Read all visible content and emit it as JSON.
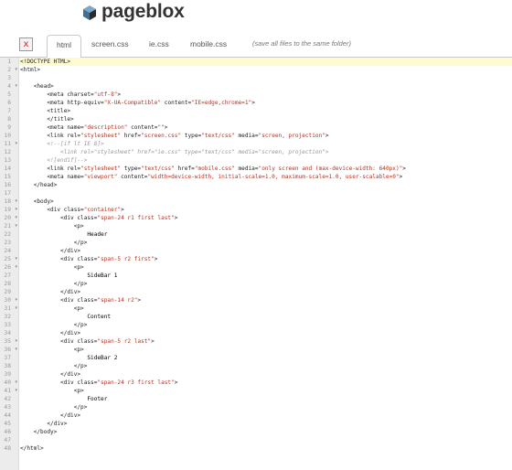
{
  "brand": {
    "name": "pageblox",
    "icon": "cube-icon"
  },
  "tabs": [
    {
      "label": "html",
      "active": true
    },
    {
      "label": "screen.css",
      "active": false
    },
    {
      "label": "ie.css",
      "active": false
    },
    {
      "label": "mobile.css",
      "active": false
    }
  ],
  "save_hint": "(save all files to the same folder)",
  "close_label": "x",
  "editor": {
    "current_line": 1,
    "lines": [
      {
        "n": "1",
        "fold": "",
        "segs": [
          [
            "tag",
            "<!DOCTYPE HTML>"
          ]
        ]
      },
      {
        "n": "2",
        "fold": "▾",
        "segs": [
          [
            "tag",
            "<html>"
          ]
        ]
      },
      {
        "n": "3",
        "fold": "",
        "segs": []
      },
      {
        "n": "4",
        "fold": "▾",
        "segs": [
          [
            "text",
            "    "
          ],
          [
            "tag",
            "<head>"
          ]
        ]
      },
      {
        "n": "5",
        "fold": "",
        "segs": [
          [
            "text",
            "        "
          ],
          [
            "tag",
            "<meta "
          ],
          [
            "attr",
            "charset="
          ],
          [
            "str",
            "\"utf-8\""
          ],
          [
            "tag",
            ">"
          ]
        ]
      },
      {
        "n": "6",
        "fold": "",
        "segs": [
          [
            "text",
            "        "
          ],
          [
            "tag",
            "<meta "
          ],
          [
            "attr",
            "http-equiv="
          ],
          [
            "str",
            "\"X-UA-Compatible\""
          ],
          [
            "attr",
            " content="
          ],
          [
            "str",
            "\"IE=edge,chrome=1\""
          ],
          [
            "tag",
            ">"
          ]
        ]
      },
      {
        "n": "7",
        "fold": "",
        "segs": [
          [
            "text",
            "        "
          ],
          [
            "tag",
            "<title>"
          ]
        ]
      },
      {
        "n": "8",
        "fold": "",
        "segs": [
          [
            "text",
            "        "
          ],
          [
            "tag",
            "</title>"
          ]
        ]
      },
      {
        "n": "9",
        "fold": "",
        "segs": [
          [
            "text",
            "        "
          ],
          [
            "tag",
            "<meta "
          ],
          [
            "attr",
            "name="
          ],
          [
            "str",
            "\"description\""
          ],
          [
            "attr",
            " content="
          ],
          [
            "str",
            "\"\""
          ],
          [
            "tag",
            ">"
          ]
        ]
      },
      {
        "n": "10",
        "fold": "",
        "segs": [
          [
            "text",
            "        "
          ],
          [
            "tag",
            "<link "
          ],
          [
            "attr",
            "rel="
          ],
          [
            "str",
            "\"stylesheet\""
          ],
          [
            "attr",
            " href="
          ],
          [
            "str",
            "\"screen.css\""
          ],
          [
            "attr",
            " type="
          ],
          [
            "str",
            "\"text/css\""
          ],
          [
            "attr",
            " media="
          ],
          [
            "str",
            "\"screen, projection\""
          ],
          [
            "tag",
            ">"
          ]
        ]
      },
      {
        "n": "11",
        "fold": "▾",
        "segs": [
          [
            "comment",
            "        <!--[if lt IE 8]>"
          ]
        ]
      },
      {
        "n": "12",
        "fold": "",
        "segs": [
          [
            "comment",
            "            <link rel=\"stylesheet\" href=\"ie.css\" type=\"text/css\" media=\"screen, projection\">"
          ]
        ]
      },
      {
        "n": "13",
        "fold": "",
        "segs": [
          [
            "comment",
            "        <![endif]-->"
          ]
        ]
      },
      {
        "n": "14",
        "fold": "",
        "segs": [
          [
            "text",
            "        "
          ],
          [
            "tag",
            "<link "
          ],
          [
            "attr",
            "rel="
          ],
          [
            "str",
            "\"stylesheet\""
          ],
          [
            "attr",
            " type="
          ],
          [
            "str",
            "\"text/css\""
          ],
          [
            "attr",
            " href="
          ],
          [
            "str",
            "\"mobile.css\""
          ],
          [
            "attr",
            " media="
          ],
          [
            "str",
            "\"only screen and (max-device-width: 640px)\""
          ],
          [
            "tag",
            ">"
          ]
        ]
      },
      {
        "n": "15",
        "fold": "",
        "segs": [
          [
            "text",
            "        "
          ],
          [
            "tag",
            "<meta "
          ],
          [
            "attr",
            "name="
          ],
          [
            "str",
            "\"viewport\""
          ],
          [
            "attr",
            " content="
          ],
          [
            "str",
            "\"width=device-width, initial-scale=1.0, maximum-scale=1.0, user-scalable=0\""
          ],
          [
            "tag",
            ">"
          ]
        ]
      },
      {
        "n": "16",
        "fold": "",
        "segs": [
          [
            "text",
            "    "
          ],
          [
            "tag",
            "</head>"
          ]
        ]
      },
      {
        "n": "17",
        "fold": "",
        "segs": []
      },
      {
        "n": "18",
        "fold": "▾",
        "segs": [
          [
            "text",
            "    "
          ],
          [
            "tag",
            "<body>"
          ]
        ]
      },
      {
        "n": "19",
        "fold": "▾",
        "segs": [
          [
            "text",
            "        "
          ],
          [
            "tag",
            "<div "
          ],
          [
            "attr",
            "class="
          ],
          [
            "str",
            "\"container\""
          ],
          [
            "tag",
            ">"
          ]
        ]
      },
      {
        "n": "20",
        "fold": "▾",
        "segs": [
          [
            "text",
            "            "
          ],
          [
            "tag",
            "<div "
          ],
          [
            "attr",
            "class="
          ],
          [
            "str",
            "\"span-24 r1 first last\""
          ],
          [
            "tag",
            ">"
          ]
        ]
      },
      {
        "n": "21",
        "fold": "▾",
        "segs": [
          [
            "text",
            "                "
          ],
          [
            "tag",
            "<p>"
          ]
        ]
      },
      {
        "n": "22",
        "fold": "",
        "segs": [
          [
            "text",
            "                    Header"
          ]
        ]
      },
      {
        "n": "23",
        "fold": "",
        "segs": [
          [
            "text",
            "                "
          ],
          [
            "tag",
            "</p>"
          ]
        ]
      },
      {
        "n": "24",
        "fold": "",
        "segs": [
          [
            "text",
            "            "
          ],
          [
            "tag",
            "</div>"
          ]
        ]
      },
      {
        "n": "25",
        "fold": "▾",
        "segs": [
          [
            "text",
            "            "
          ],
          [
            "tag",
            "<div "
          ],
          [
            "attr",
            "class="
          ],
          [
            "str",
            "\"span-5 r2 first\""
          ],
          [
            "tag",
            ">"
          ]
        ]
      },
      {
        "n": "26",
        "fold": "▾",
        "segs": [
          [
            "text",
            "                "
          ],
          [
            "tag",
            "<p>"
          ]
        ]
      },
      {
        "n": "27",
        "fold": "",
        "segs": [
          [
            "text",
            "                    SideBar 1"
          ]
        ]
      },
      {
        "n": "28",
        "fold": "",
        "segs": [
          [
            "text",
            "                "
          ],
          [
            "tag",
            "</p>"
          ]
        ]
      },
      {
        "n": "29",
        "fold": "",
        "segs": [
          [
            "text",
            "            "
          ],
          [
            "tag",
            "</div>"
          ]
        ]
      },
      {
        "n": "30",
        "fold": "▾",
        "segs": [
          [
            "text",
            "            "
          ],
          [
            "tag",
            "<div "
          ],
          [
            "attr",
            "class="
          ],
          [
            "str",
            "\"span-14 r2\""
          ],
          [
            "tag",
            ">"
          ]
        ]
      },
      {
        "n": "31",
        "fold": "▾",
        "segs": [
          [
            "text",
            "                "
          ],
          [
            "tag",
            "<p>"
          ]
        ]
      },
      {
        "n": "32",
        "fold": "",
        "segs": [
          [
            "text",
            "                    Content"
          ]
        ]
      },
      {
        "n": "33",
        "fold": "",
        "segs": [
          [
            "text",
            "                "
          ],
          [
            "tag",
            "</p>"
          ]
        ]
      },
      {
        "n": "34",
        "fold": "",
        "segs": [
          [
            "text",
            "            "
          ],
          [
            "tag",
            "</div>"
          ]
        ]
      },
      {
        "n": "35",
        "fold": "▾",
        "segs": [
          [
            "text",
            "            "
          ],
          [
            "tag",
            "<div "
          ],
          [
            "attr",
            "class="
          ],
          [
            "str",
            "\"span-5 r2 last\""
          ],
          [
            "tag",
            ">"
          ]
        ]
      },
      {
        "n": "36",
        "fold": "▾",
        "segs": [
          [
            "text",
            "                "
          ],
          [
            "tag",
            "<p>"
          ]
        ]
      },
      {
        "n": "37",
        "fold": "",
        "segs": [
          [
            "text",
            "                    SideBar 2"
          ]
        ]
      },
      {
        "n": "38",
        "fold": "",
        "segs": [
          [
            "text",
            "                "
          ],
          [
            "tag",
            "</p>"
          ]
        ]
      },
      {
        "n": "39",
        "fold": "",
        "segs": [
          [
            "text",
            "            "
          ],
          [
            "tag",
            "</div>"
          ]
        ]
      },
      {
        "n": "40",
        "fold": "▾",
        "segs": [
          [
            "text",
            "            "
          ],
          [
            "tag",
            "<div "
          ],
          [
            "attr",
            "class="
          ],
          [
            "str",
            "\"span-24 r3 first last\""
          ],
          [
            "tag",
            ">"
          ]
        ]
      },
      {
        "n": "41",
        "fold": "▾",
        "segs": [
          [
            "text",
            "                "
          ],
          [
            "tag",
            "<p>"
          ]
        ]
      },
      {
        "n": "42",
        "fold": "",
        "segs": [
          [
            "text",
            "                    Footer"
          ]
        ]
      },
      {
        "n": "43",
        "fold": "",
        "segs": [
          [
            "text",
            "                "
          ],
          [
            "tag",
            "</p>"
          ]
        ]
      },
      {
        "n": "44",
        "fold": "",
        "segs": [
          [
            "text",
            "            "
          ],
          [
            "tag",
            "</div>"
          ]
        ]
      },
      {
        "n": "45",
        "fold": "",
        "segs": [
          [
            "text",
            "        "
          ],
          [
            "tag",
            "</div>"
          ]
        ]
      },
      {
        "n": "46",
        "fold": "",
        "segs": [
          [
            "text",
            "    "
          ],
          [
            "tag",
            "</body>"
          ]
        ]
      },
      {
        "n": "47",
        "fold": "",
        "segs": []
      },
      {
        "n": "48",
        "fold": "",
        "segs": [
          [
            "tag",
            "</html>"
          ]
        ]
      }
    ]
  }
}
